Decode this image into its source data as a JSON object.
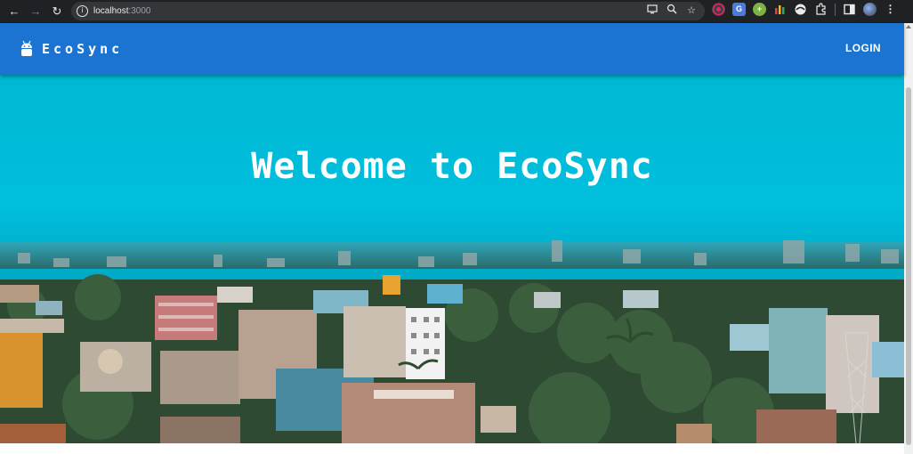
{
  "browser": {
    "url_host": "localhost",
    "url_port": ":3000",
    "icons": [
      "back-icon",
      "forward-icon",
      "reload-icon",
      "site-info-icon",
      "cast-icon",
      "zoom-icon",
      "bookmark-star-icon",
      "extensions-icon",
      "side-panel-icon",
      "profile-avatar",
      "menu-kebab-icon"
    ]
  },
  "appbar": {
    "brand": "EcoSync",
    "login_label": "LOGIN",
    "color": "#1b74d2"
  },
  "hero": {
    "title": "Welcome to EcoSync",
    "sky_color": "#00b4d4"
  }
}
